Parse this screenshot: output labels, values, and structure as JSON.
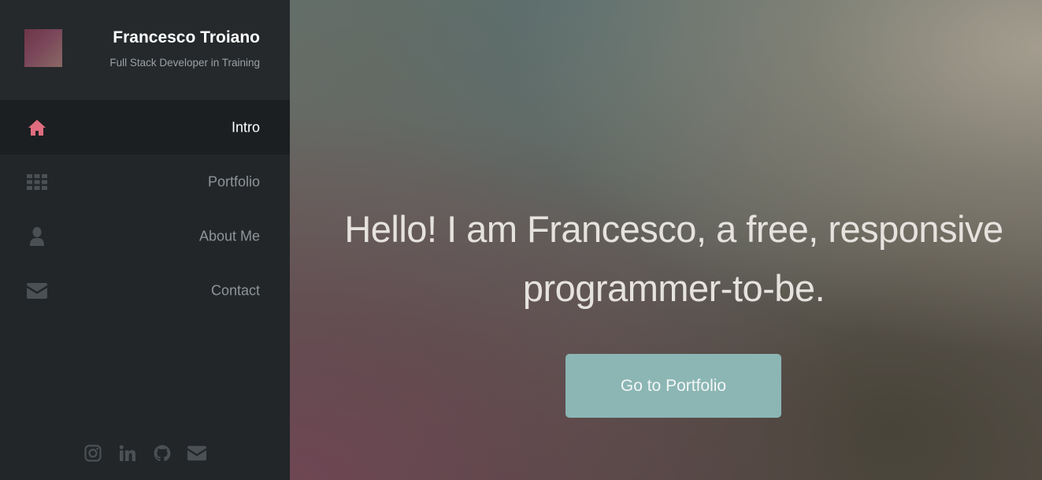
{
  "profile": {
    "name": "Francesco Troiano",
    "tagline": "Full Stack Developer in Training"
  },
  "nav": {
    "items": [
      {
        "label": "Intro",
        "icon": "home-icon",
        "active": true
      },
      {
        "label": "Portfolio",
        "icon": "grid-icon",
        "active": false
      },
      {
        "label": "About Me",
        "icon": "user-icon",
        "active": false
      },
      {
        "label": "Contact",
        "icon": "envelope-icon",
        "active": false
      }
    ]
  },
  "social": [
    "instagram-icon",
    "linkedin-icon",
    "github-icon",
    "envelope-icon"
  ],
  "hero": {
    "headline": "Hello! I am Francesco, a free, responsive programmer-to-be.",
    "cta_label": "Go to Portfolio"
  },
  "colors": {
    "accent": "#e06d7f",
    "sidebar_bg": "#222629",
    "icon_muted": "#4b5054",
    "button": "#8bb6b4"
  }
}
